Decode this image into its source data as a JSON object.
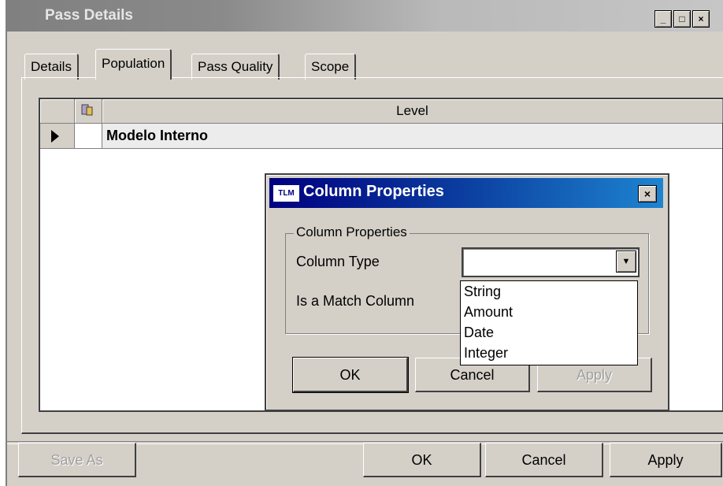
{
  "window": {
    "title": "Pass Details",
    "controls": {
      "minimize": "_",
      "maximize": "□",
      "close": "×"
    }
  },
  "tabs": [
    {
      "label": "Details",
      "active": false
    },
    {
      "label": "Population",
      "active": true
    },
    {
      "label": "Pass Quality",
      "active": false
    },
    {
      "label": "Scope",
      "active": false
    }
  ],
  "grid": {
    "header": {
      "icon": "column-settings-icon",
      "column": "Level"
    },
    "rows": [
      {
        "level": "Modelo Interno"
      }
    ]
  },
  "dialog": {
    "logo": "TLM",
    "title": "Column Properties",
    "group_label": "Column Properties",
    "column_type_label": "Column Type",
    "column_type_value": "",
    "is_match_label": "Is a Match Column",
    "dropdown_options": [
      "String",
      "Amount",
      "Date",
      "Integer"
    ],
    "buttons": {
      "ok": "OK",
      "cancel": "Cancel",
      "apply": "Apply"
    }
  },
  "footer": {
    "save_as": "Save As",
    "ok": "OK",
    "cancel": "Cancel",
    "apply": "Apply"
  },
  "colors": {
    "dialog_title_start": "#00007f",
    "dialog_title_end": "#1e84d0",
    "face": "#d4d0c8",
    "inactive_title": "#808080"
  }
}
